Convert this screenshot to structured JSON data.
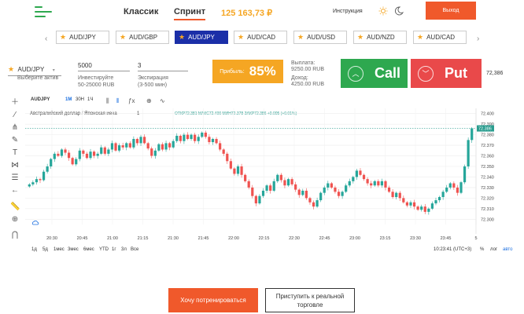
{
  "header": {
    "modes": [
      "Классик",
      "Спринт"
    ],
    "active_mode": "Спринт",
    "balance": "125 163,73 ₽",
    "instruction": "Инструкция",
    "exit": "Выход"
  },
  "assets": {
    "tabs": [
      "AUD/JPY",
      "AUD/GBP",
      "AUD/JPY",
      "AUD/CAD",
      "AUD/USD",
      "AUD/NZD",
      "AUD/CAD"
    ],
    "active_index": 2,
    "prev_arrow": "‹",
    "next_arrow": "›"
  },
  "trade": {
    "asset": "AUD/JPY",
    "asset_hint": "Выберите актив",
    "invest_value": "5000",
    "invest_hint_1": "Инвестируйте",
    "invest_hint_2": "50-25000 RUB",
    "expiry_value": "3",
    "expiry_hint_1": "Экспирация",
    "expiry_hint_2": "(3-500 мин)",
    "profit_label": "Прибыль:",
    "profit_value": "85%",
    "payout_line1": "Выплата:",
    "payout_line2": "9250.00 RUB",
    "income_line1": "Доход:",
    "income_line2": "4250.00 RUB",
    "call_label": "Call",
    "put_label": "Put",
    "side_price": "72,386"
  },
  "chart_toolbar": {
    "symbol": "AUDJPY",
    "intervals": [
      "1М",
      "30Н",
      "1Ч"
    ],
    "active_interval": "1М",
    "legend_title": "Австралийский доллар / Японская иена",
    "legend_period": "1",
    "ohlc": "ОТКР72.381  МАКС72.400  МИН72.378  ЗАКР72.386  +0.005 (+0.01%)"
  },
  "chart_bottom": {
    "ranges": [
      "1д",
      "5д",
      "1мес",
      "3мес",
      "6мес",
      "YTD",
      "1г",
      "3л",
      "Все"
    ],
    "clock": "10:23:41 (UTC+3)",
    "percent": "%",
    "log": "лог",
    "auto": "авто"
  },
  "chart_data": {
    "type": "candlestick",
    "x_ticks": [
      "20:30",
      "20:45",
      "21:00",
      "21:15",
      "21:30",
      "21:45",
      "22:00",
      "22:15",
      "22:30",
      "22:45",
      "23:00",
      "23:15",
      "23:30",
      "23:45",
      "5"
    ],
    "y_ticks": [
      72.4,
      72.39,
      72.38,
      72.37,
      72.36,
      72.35,
      72.34,
      72.33,
      72.32,
      72.31,
      72.3
    ],
    "ylim": [
      72.295,
      72.405
    ],
    "last_price": 72.386,
    "closes": [
      72.333,
      72.335,
      72.338,
      72.337,
      72.345,
      72.35,
      72.357,
      72.362,
      72.36,
      72.366,
      72.363,
      72.358,
      72.352,
      72.357,
      72.365,
      72.362,
      72.358,
      72.364,
      72.36,
      72.362,
      72.368,
      72.362,
      72.366,
      72.372,
      72.365,
      72.37,
      72.368,
      72.372,
      72.368,
      72.376,
      72.372,
      72.378,
      72.372,
      72.367,
      72.36,
      72.365,
      72.371,
      72.366,
      72.372,
      72.368,
      72.374,
      72.379,
      72.374,
      72.38,
      72.376,
      72.38,
      72.374,
      72.378,
      72.382,
      72.378,
      72.373,
      72.376,
      72.372,
      72.366,
      72.362,
      72.355,
      72.348,
      72.343,
      72.35,
      72.342,
      72.336,
      72.33,
      72.322,
      72.315,
      72.322,
      72.327,
      72.332,
      72.327,
      72.336,
      72.342,
      72.337,
      72.332,
      72.338,
      72.333,
      72.328,
      72.323,
      72.327,
      72.32,
      72.316,
      72.312,
      72.318,
      72.325,
      72.33,
      72.334,
      72.33,
      72.326,
      72.322,
      72.326,
      72.332,
      72.336,
      72.34,
      72.346,
      72.342,
      72.338,
      72.334,
      72.332,
      72.336,
      72.332,
      72.336,
      72.33,
      72.326,
      72.321,
      72.325,
      72.32,
      72.316,
      72.313,
      72.316,
      72.312,
      72.309,
      72.312,
      72.307,
      72.31,
      72.315,
      72.318,
      72.321,
      72.326,
      72.33,
      72.334,
      72.33,
      72.325,
      72.335,
      72.35,
      72.375,
      72.386
    ]
  },
  "footer": {
    "train": "Хочу потренироваться",
    "real_line1": "Приступить к реальной",
    "real_line2": "торговле"
  }
}
